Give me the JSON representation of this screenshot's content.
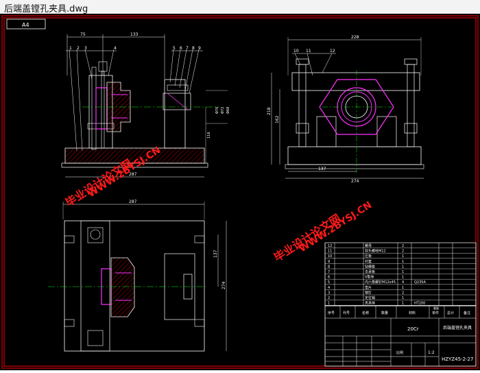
{
  "window": {
    "title": "后端盖镗孔夹具.dwg"
  },
  "colors": {
    "frame": "#ff0000",
    "outline": "#ffffff",
    "center": "#00ff00",
    "part": "#ff33ff",
    "hatch": "#ff0000",
    "watermark": "#ff1a1a"
  },
  "sheet": {
    "size_tag": "A4"
  },
  "front_view": {
    "dims_top": [
      "75",
      "133"
    ],
    "dim_bottom": "287",
    "dim_right": "116",
    "dim_right_small": [
      "Φ76",
      "Φ72",
      "Φ68"
    ],
    "balloons": [
      "1",
      "2",
      "3",
      "4",
      "5",
      "6",
      "7",
      "8",
      "9"
    ]
  },
  "side_view": {
    "dim_top": "228",
    "dims_left": [
      "218",
      "162"
    ],
    "dims_bottom": [
      "137",
      "274"
    ],
    "balloons": [
      "10",
      "11",
      "12"
    ]
  },
  "plan_view": {
    "dim_top": "287",
    "dims_right": [
      "137",
      "274"
    ]
  },
  "watermark": {
    "line1": "毕业设计论文网",
    "line2": "WWW.2BYSJ.CN"
  },
  "parts_list": {
    "rows": [
      {
        "no": "12",
        "name": "螺母",
        "qty": "2",
        "material": ""
      },
      {
        "no": "11",
        "name": "双头螺柱M12",
        "qty": "2",
        "material": ""
      },
      {
        "no": "10",
        "name": "压板",
        "qty": "1",
        "material": ""
      },
      {
        "no": "9",
        "name": "衬套",
        "qty": "1",
        "material": ""
      },
      {
        "no": "8",
        "name": "钻模板",
        "qty": "1",
        "material": ""
      },
      {
        "no": "7",
        "name": "支承板",
        "qty": "1",
        "material": ""
      },
      {
        "no": "6",
        "name": "V型块",
        "qty": "1",
        "material": ""
      },
      {
        "no": "5",
        "name": "内六角螺钉M12x45",
        "qty": "4",
        "material": "Q235A"
      },
      {
        "no": "4",
        "name": "垫片",
        "qty": "1",
        "material": ""
      },
      {
        "no": "3",
        "name": "销钉",
        "qty": "2",
        "material": ""
      },
      {
        "no": "2",
        "name": "定位销",
        "qty": "1",
        "material": ""
      },
      {
        "no": "1",
        "name": "夹具体",
        "qty": "1",
        "material": "HT200"
      }
    ],
    "headers": [
      "序号",
      "代号",
      "名称",
      "数量",
      "材料",
      "单件",
      "总计",
      "备注"
    ],
    "weight_headers": [
      "重量"
    ]
  },
  "title_block": {
    "material": "20Cr",
    "drawing_name": "后端盖镗孔夹具",
    "scale_label": "比例",
    "scale": "1:2",
    "drawing_no": "HZYZ45-2-27"
  }
}
